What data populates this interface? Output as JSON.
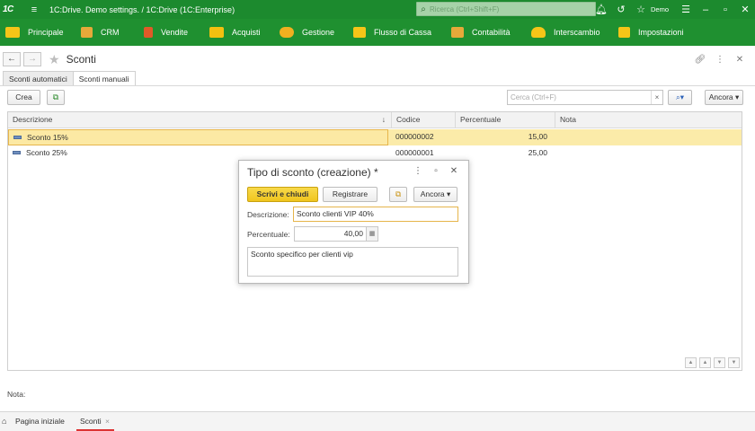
{
  "titlebar": {
    "logo": "1C",
    "title": "1C:Drive. Demo settings. / 1C:Drive  (1C:Enterprise)",
    "search_placeholder": "Ricerca (Ctrl+Shift+F)",
    "user": "Demo"
  },
  "sections": [
    {
      "label": "Principale",
      "icon_color": "#f5c518"
    },
    {
      "label": "CRM",
      "icon_color": "#f0c040"
    },
    {
      "label": "Vendite",
      "icon_color": "#e05a28"
    },
    {
      "label": "Acquisti",
      "icon_color": "#f3c010"
    },
    {
      "label": "Gestione",
      "icon_color": "#f0b020"
    },
    {
      "label": "Flusso di Cassa",
      "icon_color": "#f5c518"
    },
    {
      "label": "Contabilità",
      "icon_color": "#f0c040"
    },
    {
      "label": "Interscambio",
      "icon_color": "#f5c518"
    },
    {
      "label": "Impostazioni",
      "icon_color": "#f5c518"
    }
  ],
  "form": {
    "title": "Sconti",
    "tabs": [
      "Sconti automatici",
      "Sconti manuali"
    ],
    "create_label": "Crea",
    "search_placeholder": "Cerca (Ctrl+F)",
    "search_clear": "×",
    "more_label": "Ancora",
    "nota_label": "Nota:"
  },
  "grid": {
    "columns": [
      "Descrizione",
      "Codice",
      "Percentuale",
      "Nota"
    ],
    "rows": [
      {
        "descrizione": "Sconto 15%",
        "codice": "000000002",
        "percentuale": "15,00",
        "nota": ""
      },
      {
        "descrizione": "Sconto 25%",
        "codice": "000000001",
        "percentuale": "25,00",
        "nota": ""
      }
    ]
  },
  "dialog": {
    "title": "Tipo di sconto (creazione) *",
    "save_close_label": "Scrivi e chiudi",
    "register_label": "Registrare",
    "more_label": "Ancora",
    "descrizione_label": "Descrizione:",
    "descrizione_value": "Sconto clienti VIP 40%",
    "percentuale_label": "Percentuale:",
    "percentuale_value": "40,00",
    "memo_value": "Sconto specifico per clienti vip"
  },
  "bottom": {
    "home_label": "Pagina iniziale",
    "tab_label": "Sconti"
  },
  "colors": {
    "titlebar": "#1c8a2e",
    "sections_bg": "#1f9030",
    "selected_row": "#fbeba9",
    "primary_button": "#f0c51d"
  }
}
